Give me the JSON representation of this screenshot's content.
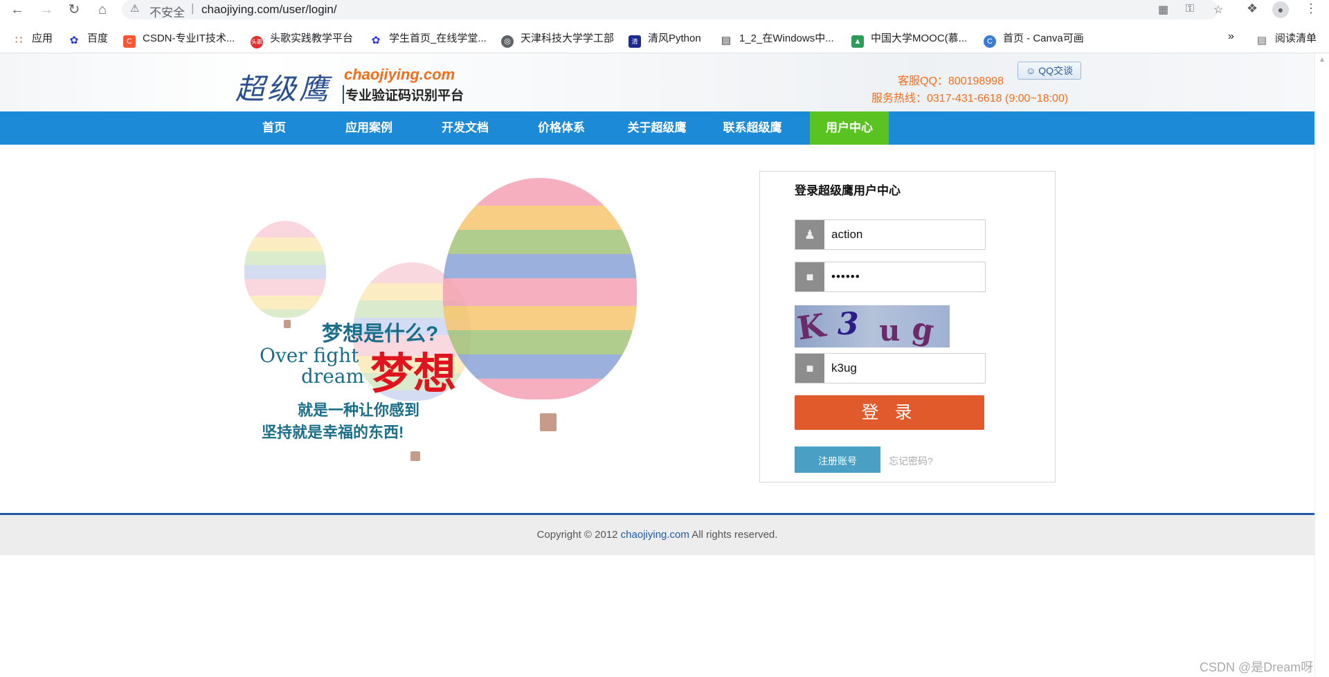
{
  "browser": {
    "insecure_label": "不安全",
    "separator": "|",
    "url": "chaojiying.com/user/login/",
    "bookmarks": [
      {
        "label": "应用",
        "icon": "apps-grid-icon",
        "color": "#4285f4"
      },
      {
        "label": "百度",
        "icon": "baidu-paw-icon",
        "color": "#2932e1"
      },
      {
        "label": "CSDN-专业IT技术...",
        "icon": "csdn-icon",
        "color": "#fc5531"
      },
      {
        "label": "头歌实践教学平台",
        "icon": "touge-icon",
        "color": "#e02d2d"
      },
      {
        "label": "学生首页_在线学堂...",
        "icon": "baidu-paw-icon",
        "color": "#2932e1"
      },
      {
        "label": "天津科技大学学工部",
        "icon": "globe-icon",
        "color": "#5f6368"
      },
      {
        "label": "清风Python",
        "icon": "qingfeng-icon",
        "color": "#1d2a8f"
      },
      {
        "label": "1_2_在Windows中...",
        "icon": "book-icon",
        "color": "#333333"
      },
      {
        "label": "中国大学MOOC(慕...",
        "icon": "mooc-icon",
        "color": "#2e9c59"
      },
      {
        "label": "首页 - Canva可画",
        "icon": "canva-icon",
        "color": "#3a7bd5"
      }
    ],
    "more_label": "»",
    "reading_list_label": "阅读清单"
  },
  "header": {
    "logo_cn": "超级鹰",
    "logo_en": "chaojiying.com",
    "logo_sub": "专业验证码识别平台",
    "service_qq": "客服QQ：800198998",
    "qq_button": "QQ交谈",
    "service_tel": "服务热线：0317-431-6618 (9:00~18:00)"
  },
  "nav": {
    "items": [
      "首页",
      "应用案例",
      "开发文档",
      "价格体系",
      "关于超级鹰",
      "联系超级鹰",
      "用户中心"
    ],
    "active_index": 6
  },
  "banner": {
    "line1": "梦想是什么?",
    "en1": "Over fight",
    "en2": "dream",
    "dream": "梦想",
    "line3": "就是一种让你感到",
    "line4": "坚持就是幸福的东西!"
  },
  "login": {
    "title": "登录超级鹰用户中心",
    "username": "action",
    "password": "••••••",
    "captcha_chars": [
      "K",
      "3",
      "u",
      "g"
    ],
    "captcha_input": "k3ug",
    "login_button": "登 录",
    "register_button": "注册账号",
    "forgot_link": "忘记密码?"
  },
  "footer": {
    "copyright_prefix": "Copyright © 2012 ",
    "copyright_link": "chaojiying.com",
    "copyright_suffix": " All rights reserved."
  },
  "watermark": "CSDN @是Dream呀",
  "colors": {
    "nav_bg": "#1c8ad6",
    "nav_active": "#5ac322",
    "accent_orange": "#f36d1a",
    "login_button": "#e05a2b",
    "register_button": "#4a9fc4",
    "footer_line": "#1d5aa3"
  }
}
